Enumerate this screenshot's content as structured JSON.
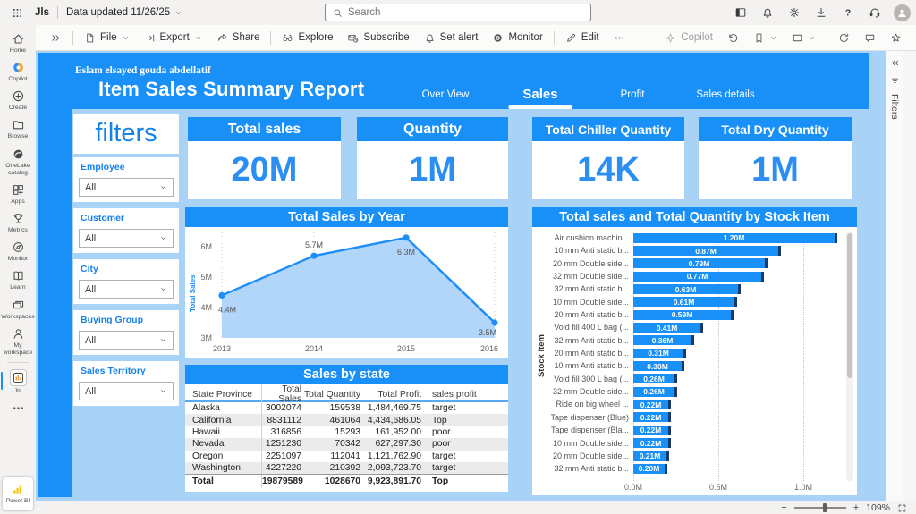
{
  "topbar": {
    "workspace_badge": "Jls",
    "dataset_status": "Data updated 11/26/25",
    "search_placeholder": "Search",
    "actions": [
      {
        "name": "navigation-pane-button",
        "icon": "layout"
      },
      {
        "name": "notifications-button",
        "icon": "bell"
      },
      {
        "name": "settings-button",
        "icon": "gear"
      },
      {
        "name": "downloads-button",
        "icon": "download"
      },
      {
        "name": "help-button",
        "icon": "question"
      },
      {
        "name": "feedback-button",
        "icon": "headset"
      }
    ]
  },
  "toolbar": {
    "items_left": [
      {
        "name": "expand-pane-button",
        "icon": "double-chevron-right",
        "label": ""
      },
      {
        "type": "divider"
      },
      {
        "name": "file-button",
        "icon": "file",
        "label": "File",
        "chevron": true
      },
      {
        "name": "export-button",
        "icon": "export",
        "label": "Export",
        "chevron": true
      },
      {
        "name": "share-button",
        "icon": "share",
        "label": "Share"
      },
      {
        "type": "divider"
      },
      {
        "name": "explore-button",
        "icon": "explore",
        "label": "Explore"
      },
      {
        "name": "subscribe-button",
        "icon": "subscribe",
        "label": "Subscribe"
      },
      {
        "name": "set-alert-button",
        "icon": "bell",
        "label": "Set alert"
      },
      {
        "name": "monitor-button",
        "icon": "monitor",
        "label": "Monitor"
      },
      {
        "type": "divider"
      },
      {
        "name": "edit-button",
        "icon": "edit",
        "label": "Edit"
      },
      {
        "name": "more-options-button",
        "icon": "ellipsis",
        "label": ""
      }
    ],
    "items_right": [
      {
        "name": "copilot-button",
        "icon": "copilot",
        "label": "Copilot",
        "disabled": true
      },
      {
        "name": "reset-button",
        "icon": "undo",
        "label": ""
      },
      {
        "name": "bookmarks-button",
        "icon": "bookmark",
        "label": "",
        "chevron": true
      },
      {
        "name": "view-button",
        "icon": "frame",
        "label": "",
        "chevron": true
      },
      {
        "type": "divider"
      },
      {
        "name": "refresh-button",
        "icon": "refresh",
        "label": ""
      },
      {
        "name": "comments-button",
        "icon": "comment",
        "label": ""
      },
      {
        "name": "favorite-button",
        "icon": "star",
        "label": ""
      }
    ]
  },
  "rail": {
    "items": [
      {
        "name": "sidebar-item-home",
        "icon": "home",
        "label": "Home"
      },
      {
        "name": "sidebar-item-copilot",
        "icon": "copilot-color",
        "label": "Copilot"
      },
      {
        "name": "sidebar-item-create",
        "icon": "plus-circle",
        "label": "Create"
      },
      {
        "name": "sidebar-item-browse",
        "icon": "folder",
        "label": "Browse"
      },
      {
        "name": "sidebar-item-onelake-catalog",
        "icon": "onelake",
        "label": "OneLake catalog"
      },
      {
        "name": "sidebar-item-apps",
        "icon": "apps",
        "label": "Apps"
      },
      {
        "name": "sidebar-item-metrics",
        "icon": "trophy",
        "label": "Metrics"
      },
      {
        "name": "sidebar-item-monitor",
        "icon": "compass",
        "label": "Monitor"
      },
      {
        "name": "sidebar-item-learn",
        "icon": "book",
        "label": "Learn"
      },
      {
        "name": "sidebar-item-workspaces",
        "icon": "workspaces",
        "label": "Workspaces"
      },
      {
        "name": "sidebar-item-my-workspace",
        "icon": "person",
        "label": "My workspace"
      },
      {
        "type": "divider"
      },
      {
        "name": "sidebar-item-jls",
        "icon": "bar-chart",
        "label": "Jls",
        "active": true
      },
      {
        "name": "sidebar-more-button",
        "icon": "ellipsis",
        "label": ""
      }
    ],
    "power_bi_label": "Power BI"
  },
  "report": {
    "author": "Eslam elsayed gouda abdellatif",
    "title": "Item Sales Summary Report",
    "tabs": [
      {
        "label": "Over View",
        "active": false
      },
      {
        "label": "Sales",
        "active": true
      },
      {
        "label": "Profit",
        "active": false
      },
      {
        "label": "Sales details",
        "active": false
      }
    ]
  },
  "filters_panel": {
    "title": "filters",
    "items": [
      {
        "label": "Employee",
        "value": "All"
      },
      {
        "label": "Customer",
        "value": "All"
      },
      {
        "label": "City",
        "value": "All"
      },
      {
        "label": "Buying Group",
        "value": "All"
      },
      {
        "label": "Sales Territory",
        "value": "All"
      }
    ]
  },
  "kpis": [
    {
      "title": "Total sales",
      "value": "20M"
    },
    {
      "title": "Quantity",
      "value": "1M"
    },
    {
      "title": "Total Chiller Quantity",
      "value": "14K"
    },
    {
      "title": "Total Dry Quantity",
      "value": "1M"
    }
  ],
  "chart_data": [
    {
      "type": "area",
      "title": "Total Sales by Year",
      "ylabel": "Total Sales",
      "x": [
        "2013",
        "2014",
        "2015",
        "2016"
      ],
      "values_millions": [
        4.4,
        5.7,
        6.3,
        3.5
      ],
      "point_labels": [
        "4.4M",
        "5.7M",
        "6.3M",
        "3.5M"
      ],
      "yticks": [
        "3M",
        "4M",
        "5M",
        "6M"
      ],
      "ylim_millions": [
        3,
        6.5
      ],
      "grid": "vertical-dotted"
    },
    {
      "type": "bar",
      "orientation": "horizontal",
      "title": "Total sales and Total Quantity by Stock Item",
      "ylabel": "Stock Item",
      "xticks": [
        "0.0M",
        "0.5M",
        "1.0M"
      ],
      "xlim_millions": [
        0,
        1.25
      ],
      "categories": [
        "Air cushion machin...",
        "10 mm Anti static b...",
        "20 mm Double side...",
        "32 mm Double side...",
        "32 mm Anti static b...",
        "10 mm Double side...",
        "20 mm Anti static b...",
        "Void fill 400 L bag (...",
        "32 mm Anti static b...",
        "20 mm Anti static b...",
        "10 mm Anti static b...",
        "Void fill 300 L bag (...",
        "32 mm Double side...",
        "Ride on big wheel ...",
        "Tape dispenser (Blue)",
        "Tape dispenser (Bla...",
        "10 mm Double side...",
        "20 mm Double side...",
        "32 mm Anti static b..."
      ],
      "values_millions": [
        1.2,
        0.87,
        0.79,
        0.77,
        0.63,
        0.61,
        0.59,
        0.41,
        0.36,
        0.31,
        0.3,
        0.26,
        0.26,
        0.22,
        0.22,
        0.22,
        0.22,
        0.21,
        0.2
      ],
      "bar_labels": [
        "1.20M",
        "0.87M",
        "0.79M",
        "0.77M",
        "0.63M",
        "0.61M",
        "0.59M",
        "0.41M",
        "0.36M",
        "0.31M",
        "0.30M",
        "0.26M",
        "0.26M",
        "0.22M",
        "0.22M",
        "0.22M",
        "0.22M",
        "0.21M",
        "0.20M"
      ]
    },
    {
      "type": "table",
      "title": "Sales by state",
      "columns": [
        "State Province",
        "Total Sales",
        "Total Quantity",
        "Total Profit",
        "sales profit"
      ],
      "rows": [
        [
          "Alaska",
          "3002074",
          "159538",
          "1,484,469.75",
          "target"
        ],
        [
          "California",
          "8831112",
          "461064",
          "4,434,686.05",
          "Top"
        ],
        [
          "Hawaii",
          "316856",
          "15293",
          "161,952.00",
          "poor"
        ],
        [
          "Nevada",
          "1251230",
          "70342",
          "627,297.30",
          "poor"
        ],
        [
          "Oregon",
          "2251097",
          "112041",
          "1,121,762.90",
          "target"
        ],
        [
          "Washington",
          "4227220",
          "210392",
          "2,093,723.70",
          "target"
        ]
      ],
      "total_row": [
        "Total",
        "19879589",
        "1028670",
        "9,923,891.70",
        "Top"
      ]
    }
  ],
  "filters_pane": {
    "label": "Filters"
  },
  "statusbar": {
    "zoom_out": "−",
    "zoom_in": "+",
    "zoom_level": "109%"
  },
  "colors": {
    "brand_blue": "#1890F8",
    "canvas_blue": "#A9D2F7",
    "kpi_value_blue": "#2B8EF2",
    "bar_cap_navy": "#173A66",
    "table_stripe": "#EBEBEB"
  }
}
